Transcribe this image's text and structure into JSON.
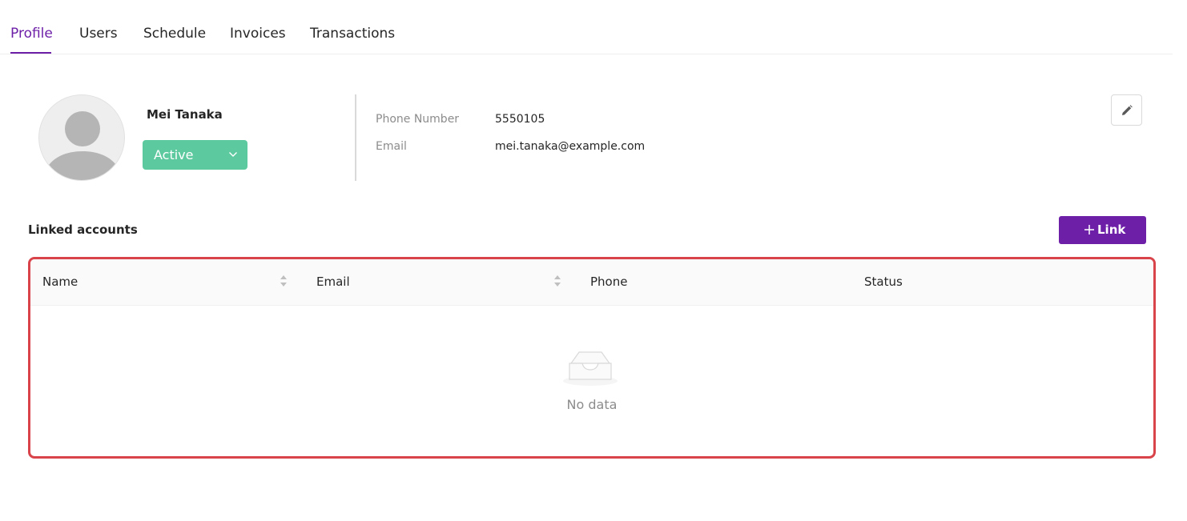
{
  "tabs": [
    {
      "label": "Profile",
      "active": true
    },
    {
      "label": "Users",
      "active": false
    },
    {
      "label": "Schedule",
      "active": false
    },
    {
      "label": "Invoices",
      "active": false
    },
    {
      "label": "Transactions",
      "active": false
    }
  ],
  "profile": {
    "name": "Mei Tanaka",
    "status": "Active",
    "fields": [
      {
        "label": "Phone Number",
        "value": "5550105"
      },
      {
        "label": "Email",
        "value": "mei.tanaka@example.com"
      }
    ]
  },
  "linked_accounts": {
    "title": "Linked accounts",
    "link_button": "Link",
    "columns": [
      "Name",
      "Email",
      "Phone",
      "Status"
    ],
    "rows": [],
    "empty_text": "No data"
  },
  "colors": {
    "accent": "#6d1fa8",
    "status_active": "#5cc99f",
    "highlight_border": "#d9444b"
  }
}
